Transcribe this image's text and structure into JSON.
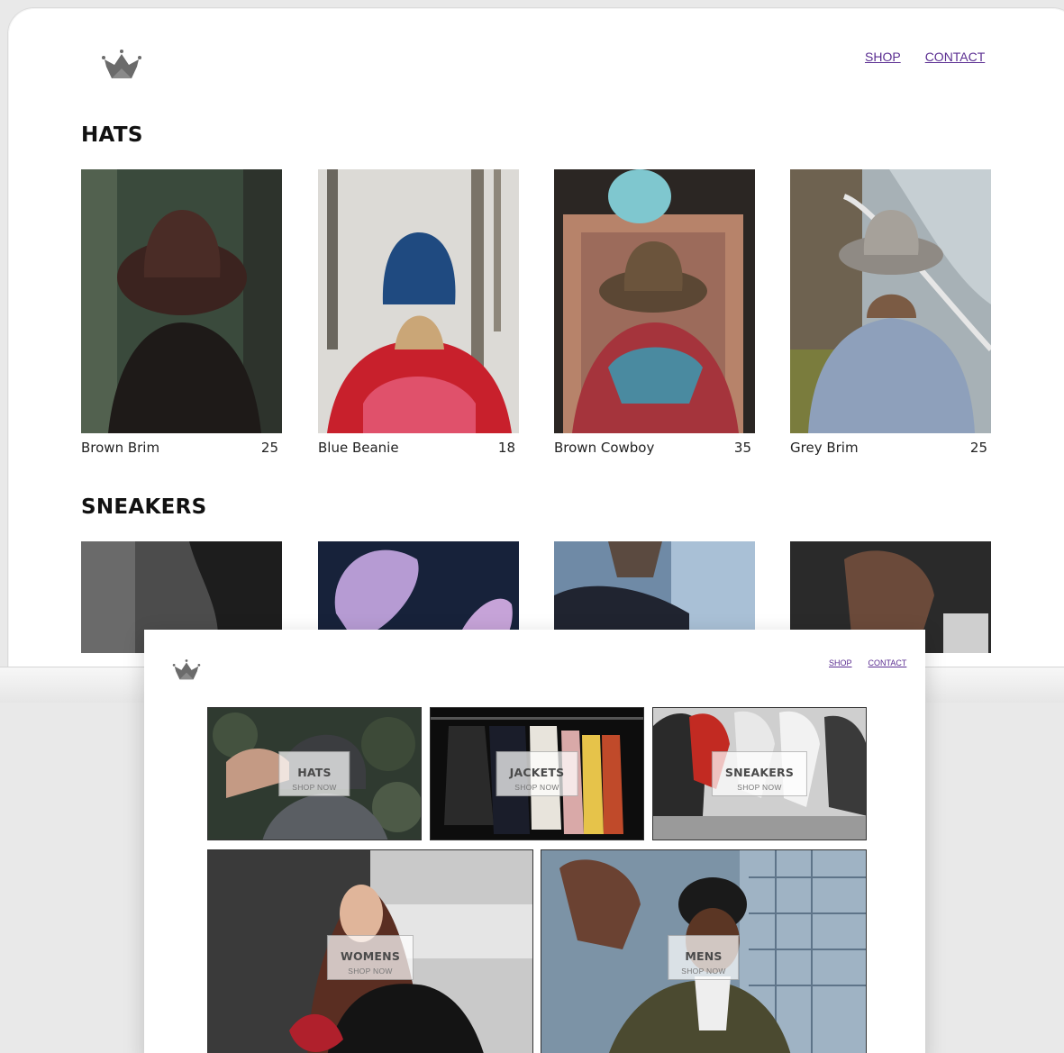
{
  "back_page": {
    "nav": {
      "shop": "SHOP",
      "contact": "CONTACT"
    },
    "sections": [
      {
        "title": "HATS",
        "products": [
          {
            "name": "Brown Brim",
            "price": "25"
          },
          {
            "name": "Blue Beanie",
            "price": "18"
          },
          {
            "name": "Brown Cowboy",
            "price": "35"
          },
          {
            "name": "Grey Brim",
            "price": "25"
          }
        ]
      },
      {
        "title": "SNEAKERS"
      }
    ]
  },
  "front_page": {
    "nav": {
      "shop": "SHOP",
      "contact": "CONTACT"
    },
    "categories": [
      {
        "title": "HATS",
        "cta": "SHOP NOW"
      },
      {
        "title": "JACKETS",
        "cta": "SHOP NOW"
      },
      {
        "title": "SNEAKERS",
        "cta": "SHOP NOW"
      },
      {
        "title": "WOMENS",
        "cta": "SHOP NOW"
      },
      {
        "title": "MENS",
        "cta": "SHOP NOW"
      }
    ]
  },
  "colors": {
    "link": "#5a2d91",
    "logo": "#6b6b6b"
  },
  "icons": {
    "logo": "crown-icon"
  }
}
